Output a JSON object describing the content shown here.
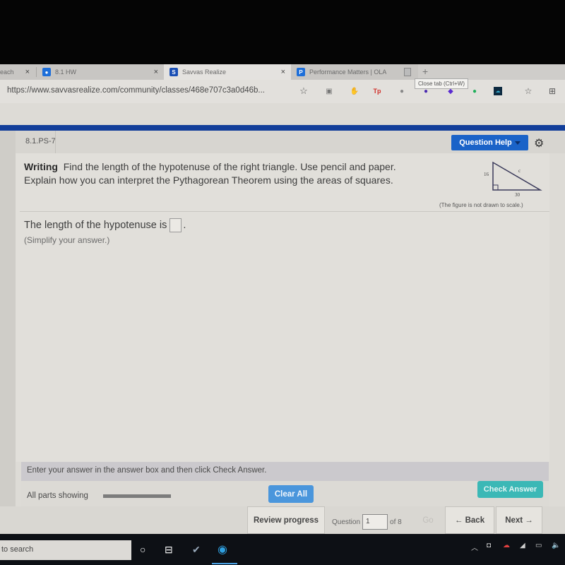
{
  "browser": {
    "tabs": [
      {
        "label": "each",
        "active": false,
        "close": "×"
      },
      {
        "label": "8.1 HW",
        "active": false,
        "favicon": "person-icon",
        "favicon_color": "#1e6fd9",
        "close": "×"
      },
      {
        "label": "Savvas Realize",
        "active": true,
        "favicon": "savvas-icon",
        "favicon_color": "#1a4fb5",
        "close": "×"
      },
      {
        "label": "Performance Matters | OLA",
        "active": false,
        "favicon": "P",
        "favicon_color": "#1e6fd9"
      }
    ],
    "new_tab": "+",
    "tooltip": "Close tab (Ctrl+W)",
    "url": "https://www.savvasrealize.com/community/classes/468e707c3a0d46b...",
    "toolbar_icons": [
      "star-icon",
      "extension-icon",
      "hand-icon",
      "tp-icon",
      "circle-icon",
      "w-icon",
      "puzzle-icon",
      "grammarly-icon",
      "cloud-icon",
      "favorites-icon",
      "collections-icon"
    ]
  },
  "header": {
    "question_id": "8.1.PS-7",
    "question_help": "Question Help",
    "accent": "#1a63c8",
    "top_bar_color": "#123e9a"
  },
  "question": {
    "label": "Writing",
    "text1": "Find the length of the hypotenuse of the right triangle. Use pencil and paper.",
    "text2": "Explain how you can interpret the Pythagorean Theorem using the areas of squares.",
    "figure": {
      "leg_vertical": "16",
      "leg_horizontal": "30",
      "hypotenuse": "c"
    },
    "figure_caption": "(The figure is not drawn to scale.)"
  },
  "answer": {
    "prefix": "The length of the hypotenuse is",
    "value": "",
    "suffix": ".",
    "hint": "(Simplify your answer.)"
  },
  "footer": {
    "instruction": "Enter your answer in the answer box and then click Check Answer.",
    "parts_label": "All parts showing",
    "parts_progress": 1.0,
    "clear_all": "Clear All",
    "check_answer": "Check Answer"
  },
  "nav": {
    "review_progress": "Review progress",
    "question_label": "Question",
    "question_number": "1",
    "of_total": "of 8",
    "go": "Go",
    "back": "← Back",
    "next": "Next →"
  },
  "taskbar": {
    "search_text": "to search",
    "icons": [
      "cortana-icon",
      "task-view-icon",
      "steam-icon",
      "edge-icon"
    ],
    "tray": [
      "chevron-up-icon",
      "meet-icon",
      "onedrive-icon",
      "wifi-icon",
      "battery-icon",
      "volume-icon"
    ]
  }
}
